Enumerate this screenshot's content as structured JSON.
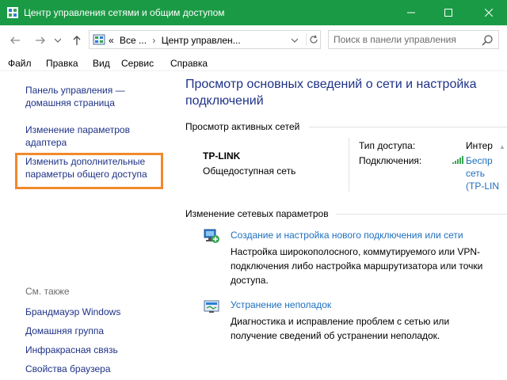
{
  "window": {
    "title": "Центр управления сетями и общим доступом",
    "accent_color": "#1b9a45"
  },
  "address_bar": {
    "segment_prefix": "«",
    "segment_1": "Все ...",
    "segment_2": "Центр управлен...",
    "search_placeholder": "Поиск в панели управления"
  },
  "menu": [
    "Файл",
    "Правка",
    "Вид",
    "Сервис",
    "Справка"
  ],
  "left_pane": {
    "links": [
      "Панель управления — домашняя страница",
      "Изменение параметров адаптера",
      "Изменить дополнительные параметры общего доступа"
    ],
    "see_also_label": "См. также",
    "see_also": [
      "Брандмауэр Windows",
      "Домашняя группа",
      "Инфракрасная связь",
      "Свойства браузера"
    ],
    "highlight_color": "#f1892b"
  },
  "main": {
    "title": "Просмотр основных сведений о сети и настройка подключений",
    "active_networks_label": "Просмотр активных сетей",
    "network": {
      "name": "TP-LINK",
      "type": "Общедоступная сеть",
      "access_label": "Тип доступа:",
      "access_value": "Интер",
      "connections_label": "Подключения:",
      "connection_line1": "Беспр",
      "connection_line2": "сеть",
      "connection_line3": "(TP-LIN"
    },
    "change_settings_label": "Изменение сетевых параметров",
    "tasks": [
      {
        "icon": "network-setup-icon",
        "link": "Создание и настройка нового подключения или сети",
        "description": "Настройка широкополосного, коммутируемого или VPN-подключения либо настройка маршрутизатора или точки доступа."
      },
      {
        "icon": "troubleshoot-icon",
        "link": "Устранение неполадок",
        "description": "Диагностика и исправление проблем с сетью или получение сведений об устранении неполадок."
      }
    ]
  }
}
